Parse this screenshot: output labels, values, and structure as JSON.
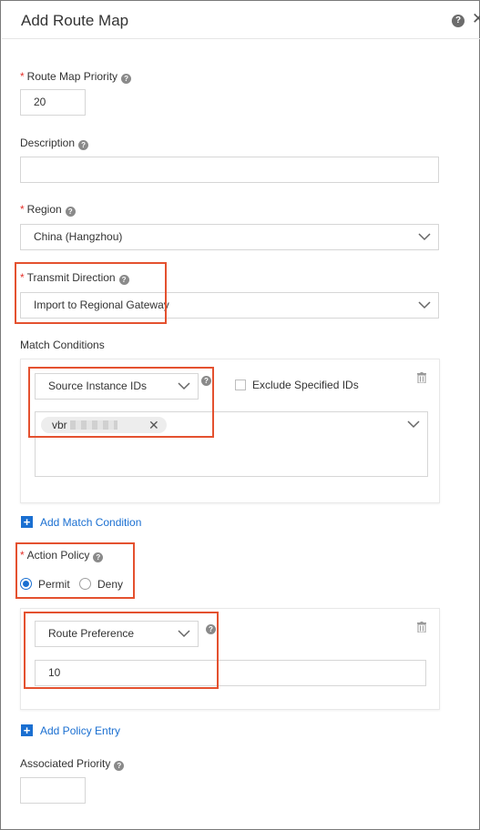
{
  "dialog": {
    "title": "Add Route Map",
    "help_icon": "question-circle-icon",
    "close_icon": "close-icon"
  },
  "fields": {
    "priority": {
      "label": "Route Map Priority",
      "value": "20"
    },
    "description": {
      "label": "Description",
      "value": ""
    },
    "region": {
      "label": "Region",
      "selected": "China (Hangzhou)"
    },
    "transmit_direction": {
      "label": "Transmit Direction",
      "selected": "Import to Regional Gateway"
    }
  },
  "match_conditions": {
    "label": "Match Conditions",
    "condition_type": "Source Instance IDs",
    "exclude_label": "Exclude Specified IDs",
    "exclude_checked": false,
    "tag_prefix": "vbr",
    "add_label": "Add Match Condition"
  },
  "action_policy": {
    "label": "Action Policy",
    "options": [
      "Permit",
      "Deny"
    ],
    "selected": "Permit"
  },
  "policy_entry": {
    "type": "Route Preference",
    "value": "10",
    "add_label": "Add Policy Entry"
  },
  "associated_priority": {
    "label": "Associated Priority",
    "value": ""
  },
  "colors": {
    "accent": "#1a6fd1",
    "required": "#e5322b",
    "highlight": "#e4512f",
    "border": "#d6d6d6"
  }
}
